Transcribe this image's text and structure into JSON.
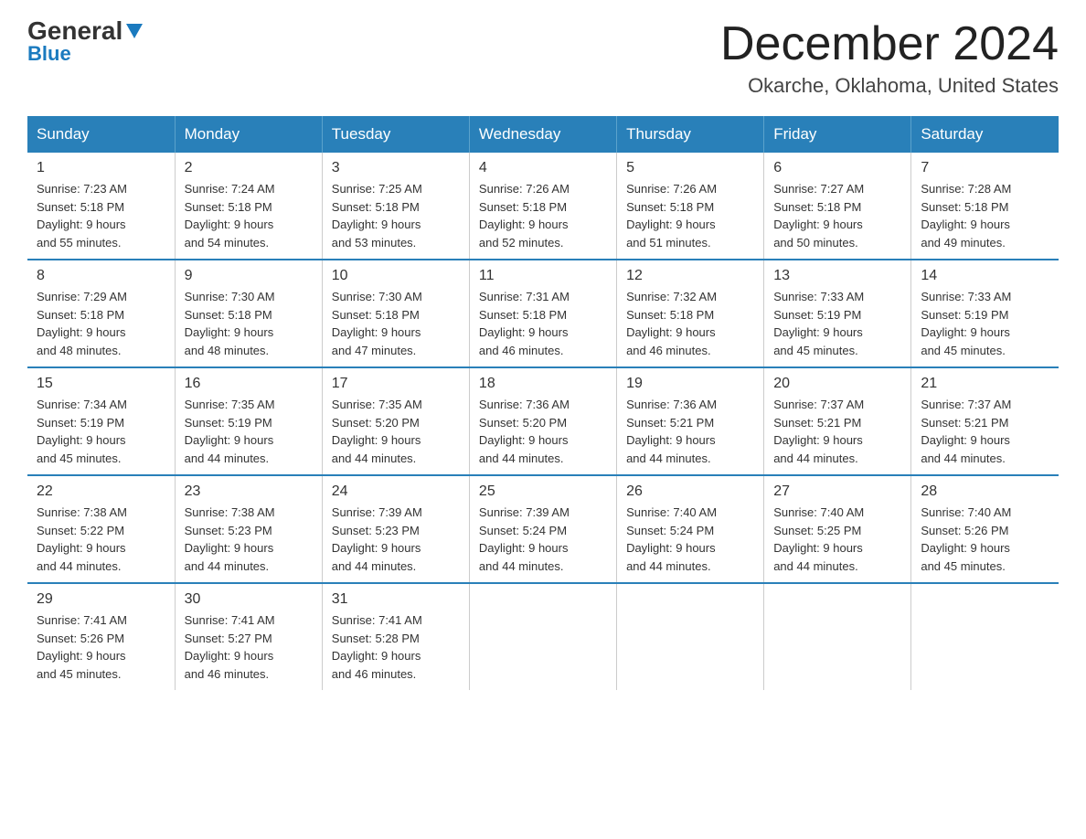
{
  "header": {
    "logo_general": "General",
    "logo_blue": "Blue",
    "month_title": "December 2024",
    "location": "Okarche, Oklahoma, United States"
  },
  "weekdays": [
    "Sunday",
    "Monday",
    "Tuesday",
    "Wednesday",
    "Thursday",
    "Friday",
    "Saturday"
  ],
  "weeks": [
    [
      {
        "day": "1",
        "sunrise": "7:23 AM",
        "sunset": "5:18 PM",
        "daylight": "9 hours and 55 minutes."
      },
      {
        "day": "2",
        "sunrise": "7:24 AM",
        "sunset": "5:18 PM",
        "daylight": "9 hours and 54 minutes."
      },
      {
        "day": "3",
        "sunrise": "7:25 AM",
        "sunset": "5:18 PM",
        "daylight": "9 hours and 53 minutes."
      },
      {
        "day": "4",
        "sunrise": "7:26 AM",
        "sunset": "5:18 PM",
        "daylight": "9 hours and 52 minutes."
      },
      {
        "day": "5",
        "sunrise": "7:26 AM",
        "sunset": "5:18 PM",
        "daylight": "9 hours and 51 minutes."
      },
      {
        "day": "6",
        "sunrise": "7:27 AM",
        "sunset": "5:18 PM",
        "daylight": "9 hours and 50 minutes."
      },
      {
        "day": "7",
        "sunrise": "7:28 AM",
        "sunset": "5:18 PM",
        "daylight": "9 hours and 49 minutes."
      }
    ],
    [
      {
        "day": "8",
        "sunrise": "7:29 AM",
        "sunset": "5:18 PM",
        "daylight": "9 hours and 48 minutes."
      },
      {
        "day": "9",
        "sunrise": "7:30 AM",
        "sunset": "5:18 PM",
        "daylight": "9 hours and 48 minutes."
      },
      {
        "day": "10",
        "sunrise": "7:30 AM",
        "sunset": "5:18 PM",
        "daylight": "9 hours and 47 minutes."
      },
      {
        "day": "11",
        "sunrise": "7:31 AM",
        "sunset": "5:18 PM",
        "daylight": "9 hours and 46 minutes."
      },
      {
        "day": "12",
        "sunrise": "7:32 AM",
        "sunset": "5:18 PM",
        "daylight": "9 hours and 46 minutes."
      },
      {
        "day": "13",
        "sunrise": "7:33 AM",
        "sunset": "5:19 PM",
        "daylight": "9 hours and 45 minutes."
      },
      {
        "day": "14",
        "sunrise": "7:33 AM",
        "sunset": "5:19 PM",
        "daylight": "9 hours and 45 minutes."
      }
    ],
    [
      {
        "day": "15",
        "sunrise": "7:34 AM",
        "sunset": "5:19 PM",
        "daylight": "9 hours and 45 minutes."
      },
      {
        "day": "16",
        "sunrise": "7:35 AM",
        "sunset": "5:19 PM",
        "daylight": "9 hours and 44 minutes."
      },
      {
        "day": "17",
        "sunrise": "7:35 AM",
        "sunset": "5:20 PM",
        "daylight": "9 hours and 44 minutes."
      },
      {
        "day": "18",
        "sunrise": "7:36 AM",
        "sunset": "5:20 PM",
        "daylight": "9 hours and 44 minutes."
      },
      {
        "day": "19",
        "sunrise": "7:36 AM",
        "sunset": "5:21 PM",
        "daylight": "9 hours and 44 minutes."
      },
      {
        "day": "20",
        "sunrise": "7:37 AM",
        "sunset": "5:21 PM",
        "daylight": "9 hours and 44 minutes."
      },
      {
        "day": "21",
        "sunrise": "7:37 AM",
        "sunset": "5:21 PM",
        "daylight": "9 hours and 44 minutes."
      }
    ],
    [
      {
        "day": "22",
        "sunrise": "7:38 AM",
        "sunset": "5:22 PM",
        "daylight": "9 hours and 44 minutes."
      },
      {
        "day": "23",
        "sunrise": "7:38 AM",
        "sunset": "5:23 PM",
        "daylight": "9 hours and 44 minutes."
      },
      {
        "day": "24",
        "sunrise": "7:39 AM",
        "sunset": "5:23 PM",
        "daylight": "9 hours and 44 minutes."
      },
      {
        "day": "25",
        "sunrise": "7:39 AM",
        "sunset": "5:24 PM",
        "daylight": "9 hours and 44 minutes."
      },
      {
        "day": "26",
        "sunrise": "7:40 AM",
        "sunset": "5:24 PM",
        "daylight": "9 hours and 44 minutes."
      },
      {
        "day": "27",
        "sunrise": "7:40 AM",
        "sunset": "5:25 PM",
        "daylight": "9 hours and 44 minutes."
      },
      {
        "day": "28",
        "sunrise": "7:40 AM",
        "sunset": "5:26 PM",
        "daylight": "9 hours and 45 minutes."
      }
    ],
    [
      {
        "day": "29",
        "sunrise": "7:41 AM",
        "sunset": "5:26 PM",
        "daylight": "9 hours and 45 minutes."
      },
      {
        "day": "30",
        "sunrise": "7:41 AM",
        "sunset": "5:27 PM",
        "daylight": "9 hours and 46 minutes."
      },
      {
        "day": "31",
        "sunrise": "7:41 AM",
        "sunset": "5:28 PM",
        "daylight": "9 hours and 46 minutes."
      },
      null,
      null,
      null,
      null
    ]
  ],
  "labels": {
    "sunrise_prefix": "Sunrise: ",
    "sunset_prefix": "Sunset: ",
    "daylight_prefix": "Daylight: "
  }
}
